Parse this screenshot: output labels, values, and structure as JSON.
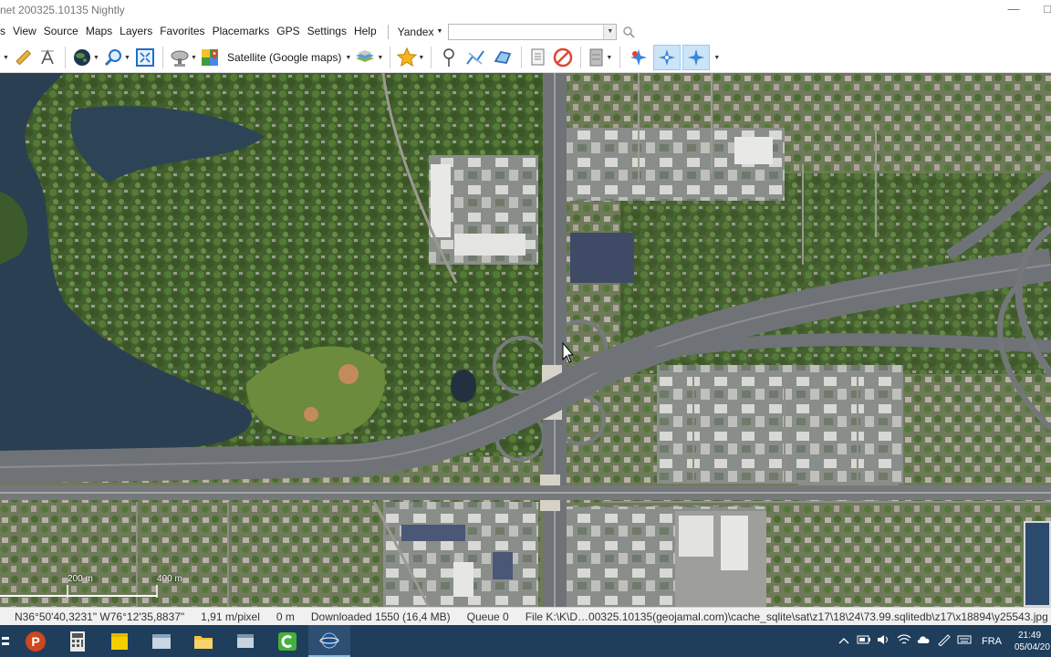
{
  "window": {
    "title": "net 200325.10135 Nightly",
    "minimize_glyph": "—",
    "restore_glyph": "□"
  },
  "menu": {
    "items": [
      "s",
      "View",
      "Source",
      "Maps",
      "Layers",
      "Favorites",
      "Placemarks",
      "GPS",
      "Settings",
      "Help"
    ],
    "search_provider": "Yandex",
    "search_value": ""
  },
  "toolbar": {
    "map_layer_label": "Satellite (Google maps)",
    "icons": [
      "ruler-icon",
      "text-tool-icon",
      "globe-icon",
      "zoom-icon",
      "fullscreen-icon",
      "satellite-dish-icon",
      "google-maps-icon",
      "layers-icon",
      "favorites-star-icon",
      "placemark-pin-icon",
      "path-icon",
      "polygon-icon",
      "notes-icon",
      "cancel-icon",
      "cache-icon",
      "gps-target-icon",
      "gps-follow-icon",
      "gps-center-icon"
    ]
  },
  "map": {
    "scale_labels": [
      "200 m",
      "400 m"
    ],
    "colors": {
      "water": "#2a3f52",
      "vegetation": "#3f5a2a",
      "road": "#6f7377"
    }
  },
  "status": {
    "coordinates": "N36°50'40,3231\"  W76°12'35,8837\"",
    "resolution": "1,91 m/pixel",
    "elevation": "0 m",
    "downloaded": "Downloaded 1550 (16,4 MB)",
    "queue": "Queue 0",
    "file": "File K:\\K\\D…00325.10135(geojamal.com)\\cache_sqlite\\sat\\z17\\18\\24\\73.99.sqlitedb\\z17\\x18894\\y25543.jpg"
  },
  "taskbar": {
    "apps": [
      "powerpoint-app-icon",
      "calculator-app-icon",
      "sticky-notes-app-icon",
      "app-window-icon",
      "file-explorer-app-icon",
      "app-window-icon-2",
      "camtasia-app-icon",
      "sasplanet-app-icon"
    ],
    "language": "FRA",
    "time": "21:49",
    "date": "05/04/20"
  }
}
